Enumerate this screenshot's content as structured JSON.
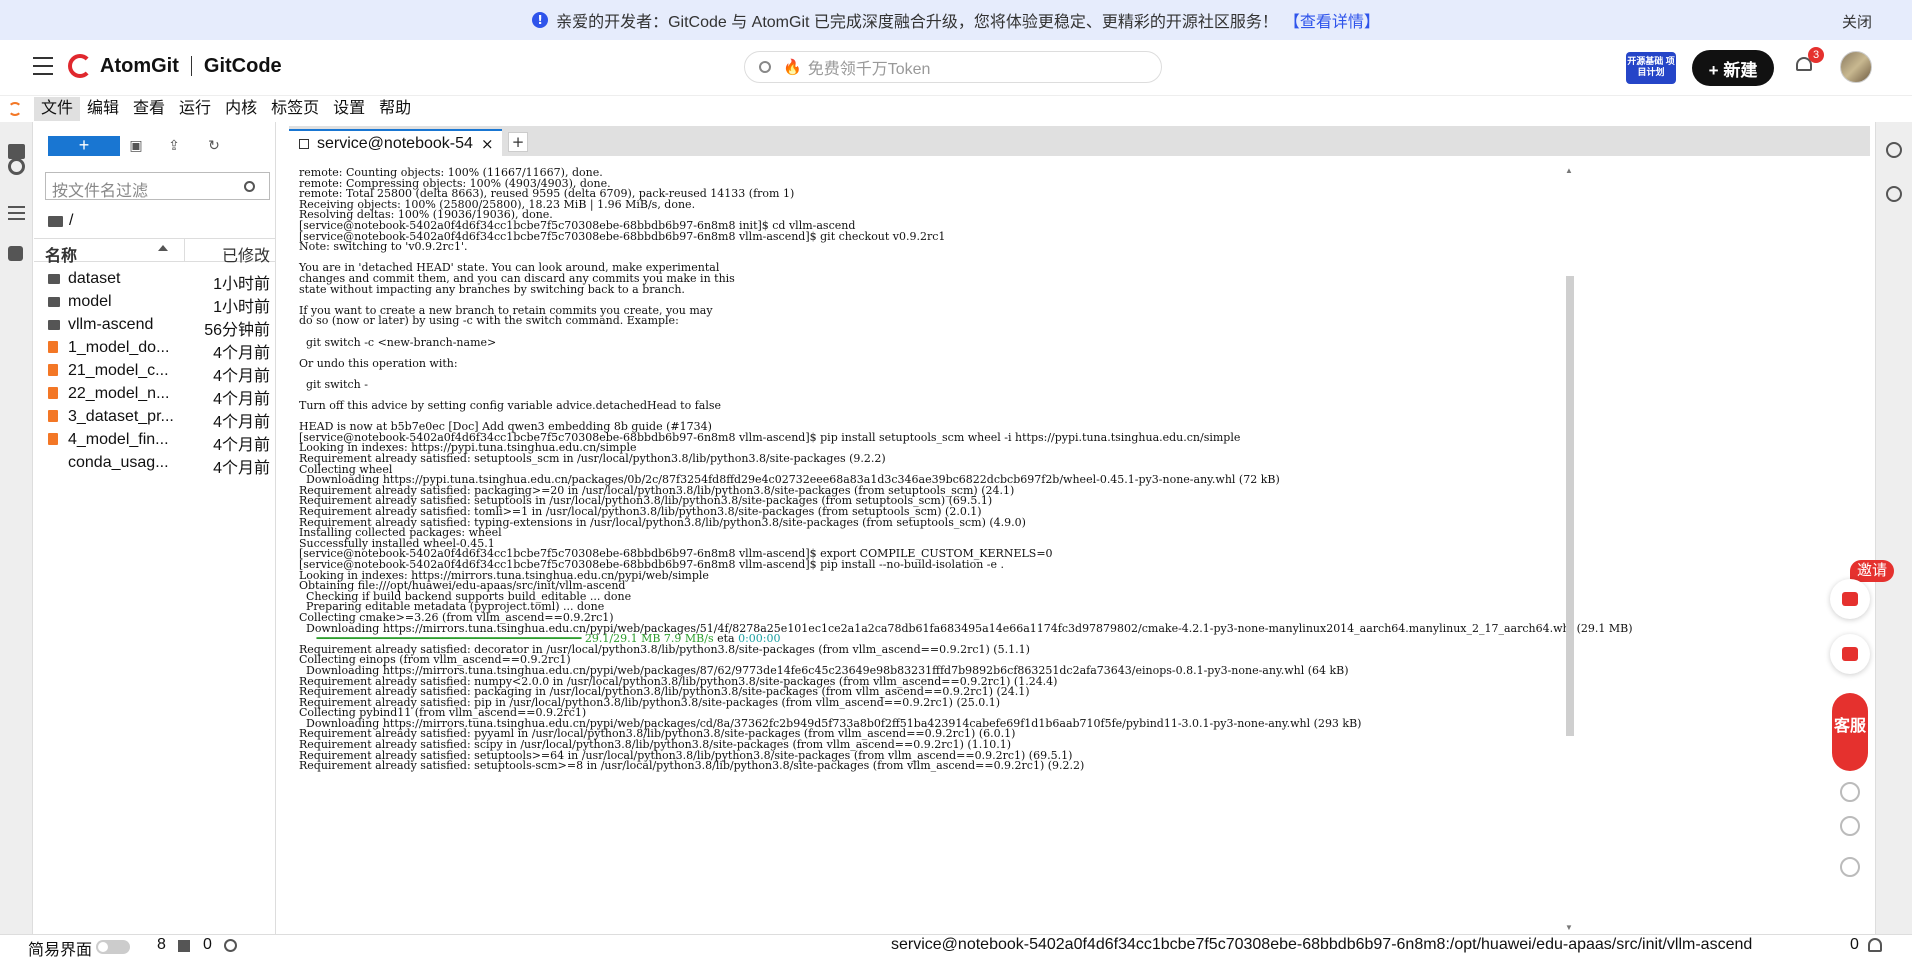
{
  "banner": {
    "text": "亲爱的开发者：GitCode 与 AtomGit 已完成深度融合升级，您将体验更稳定、更精彩的开源社区服务！",
    "link": "【查看详情】",
    "close": "关闭"
  },
  "topnav": {
    "brand_a": "AtomGit",
    "brand_b": "GitCode",
    "search_placeholder": "免费领千万Token",
    "promo": "开源基础 项目计划",
    "new_button": "+ 新建",
    "notification_count": "3"
  },
  "menubar": [
    "文件",
    "编辑",
    "查看",
    "运行",
    "内核",
    "标签页",
    "设置",
    "帮助"
  ],
  "filebrowser": {
    "new_label": "+",
    "filter_placeholder": "按文件名过滤",
    "breadcrumb": "/",
    "col_name": "名称",
    "col_modified": "已修改",
    "files": [
      {
        "name": "dataset",
        "time": "1小时前",
        "type": "folder"
      },
      {
        "name": "model",
        "time": "1小时前",
        "type": "folder"
      },
      {
        "name": "vllm-ascend",
        "time": "56分钟前",
        "type": "folder"
      },
      {
        "name": "1_model_do...",
        "time": "4个月前",
        "type": "notebook"
      },
      {
        "name": "21_model_c...",
        "time": "4个月前",
        "type": "notebook"
      },
      {
        "name": "22_model_n...",
        "time": "4个月前",
        "type": "notebook"
      },
      {
        "name": "3_dataset_pr...",
        "time": "4个月前",
        "type": "notebook"
      },
      {
        "name": "4_model_fin...",
        "time": "4个月前",
        "type": "notebook"
      },
      {
        "name": "conda_usag...",
        "time": "4个月前",
        "type": "pdf"
      }
    ]
  },
  "tab": {
    "label": "service@notebook-5402a0f4d6f34cc1bcbe7f5c70308ebe-68bbdb6b97-6n8m8",
    "close": "×",
    "add": "+"
  },
  "terminal": {
    "lines_a": "remote: Counting objects: 100% (11667/11667), done.\nremote: Compressing objects: 100% (4903/4903), done.\nremote: Total 25800 (delta 8663), reused 9595 (delta 6709), pack-reused 14133 (from 1)\nReceiving objects: 100% (25800/25800), 18.23 MiB | 1.96 MiB/s, done.\nResolving deltas: 100% (19036/19036), done.\n[service@notebook-5402a0f4d6f34cc1bcbe7f5c70308ebe-68bbdb6b97-6n8m8 init]$ cd vllm-ascend\n[service@notebook-5402a0f4d6f34cc1bcbe7f5c70308ebe-68bbdb6b97-6n8m8 vllm-ascend]$ git checkout v0.9.2rc1\nNote: switching to 'v0.9.2rc1'.\n\nYou are in 'detached HEAD' state. You can look around, make experimental\nchanges and commit them, and you can discard any commits you make in this\nstate without impacting any branches by switching back to a branch.\n\nIf you want to create a new branch to retain commits you create, you may\ndo so (now or later) by using -c with the switch command. Example:\n\n  git switch -c <new-branch-name>\n\nOr undo this operation with:\n\n  git switch -\n\nTurn off this advice by setting config variable advice.detachedHead to false\n\nHEAD is now at b5b7e0ec [Doc] Add qwen3 embedding 8b guide (#1734)\n[service@notebook-5402a0f4d6f34cc1bcbe7f5c70308ebe-68bbdb6b97-6n8m8 vllm-ascend]$ pip install setuptools_scm wheel -i https://pypi.tuna.tsinghua.edu.cn/simple\nLooking in indexes: https://pypi.tuna.tsinghua.edu.cn/simple\nRequirement already satisfied: setuptools_scm in /usr/local/python3.8/lib/python3.8/site-packages (9.2.2)\nCollecting wheel\n  Downloading https://pypi.tuna.tsinghua.edu.cn/packages/0b/2c/87f3254fd8ffd29e4c02732eee68a83a1d3c346ae39bc6822dcbcb697f2b/wheel-0.45.1-py3-none-any.whl (72 kB)\nRequirement already satisfied: packaging>=20 in /usr/local/python3.8/lib/python3.8/site-packages (from setuptools_scm) (24.1)\nRequirement already satisfied: setuptools in /usr/local/python3.8/lib/python3.8/site-packages (from setuptools_scm) (69.5.1)\nRequirement already satisfied: tomli>=1 in /usr/local/python3.8/lib/python3.8/site-packages (from setuptools_scm) (2.0.1)\nRequirement already satisfied: typing-extensions in /usr/local/python3.8/lib/python3.8/site-packages (from setuptools_scm) (4.9.0)\nInstalling collected packages: wheel\nSuccessfully installed wheel-0.45.1\n[service@notebook-5402a0f4d6f34cc1bcbe7f5c70308ebe-68bbdb6b97-6n8m8 vllm-ascend]$ export COMPILE_CUSTOM_KERNELS=0\n[service@notebook-5402a0f4d6f34cc1bcbe7f5c70308ebe-68bbdb6b97-6n8m8 vllm-ascend]$ pip install --no-build-isolation -e .\nLooking in indexes: https://mirrors.tuna.tsinghua.edu.cn/pypi/web/simple\nObtaining file:///opt/huawei/edu-apaas/src/init/vllm-ascend\n  Checking if build backend supports build_editable ... done\n  Preparing editable metadata (pyproject.toml) ... done\nCollecting cmake>=3.26 (from vllm_ascend==0.9.2rc1)\n  Downloading https://mirrors.tuna.tsinghua.edu.cn/pypi/web/packages/51/4f/8278a25e101ec1ce2a1a2ca78db61fa683495a14e66a1174fc3d97879802/cmake-4.2.1-py3-none-manylinux2014_aarch64.manylinux_2_17_aarch64.whl (29.1 MB)",
    "progress_bar": "     ━━━━━━━━━━━━━━━━━━━━━━━━━━━━━━━━━━━━━━━━ ",
    "progress_text": "29.1/29.1 MB 7.9 MB/s",
    "progress_eta": " eta ",
    "progress_time": "0:00:00",
    "lines_b": "Requirement already satisfied: decorator in /usr/local/python3.8/lib/python3.8/site-packages (from vllm_ascend==0.9.2rc1) (5.1.1)\nCollecting einops (from vllm_ascend==0.9.2rc1)\n  Downloading https://mirrors.tuna.tsinghua.edu.cn/pypi/web/packages/87/62/9773de14fe6c45c23649e98b83231fffd7b9892b6cf863251dc2afa73643/einops-0.8.1-py3-none-any.whl (64 kB)\nRequirement already satisfied: numpy<2.0.0 in /usr/local/python3.8/lib/python3.8/site-packages (from vllm_ascend==0.9.2rc1) (1.24.4)\nRequirement already satisfied: packaging in /usr/local/python3.8/lib/python3.8/site-packages (from vllm_ascend==0.9.2rc1) (24.1)\nRequirement already satisfied: pip in /usr/local/python3.8/lib/python3.8/site-packages (from vllm_ascend==0.9.2rc1) (25.0.1)\nCollecting pybind11 (from vllm_ascend==0.9.2rc1)\n  Downloading https://mirrors.tuna.tsinghua.edu.cn/pypi/web/packages/cd/8a/37362fc2b949d5f733a8b0f2ff51ba423914cabefe69f1d1b6aab710f5fe/pybind11-3.0.1-py3-none-any.whl (293 kB)\nRequirement already satisfied: pyyaml in /usr/local/python3.8/lib/python3.8/site-packages (from vllm_ascend==0.9.2rc1) (6.0.1)\nRequirement already satisfied: scipy in /usr/local/python3.8/lib/python3.8/site-packages (from vllm_ascend==0.9.2rc1) (1.10.1)\nRequirement already satisfied: setuptools>=64 in /usr/local/python3.8/lib/python3.8/site-packages (from vllm_ascend==0.9.2rc1) (69.5.1)\nRequirement already satisfied: setuptools-scm>=8 in /usr/local/python3.8/lib/python3.8/site-packages (from vllm_ascend==0.9.2rc1) (9.2.2)"
  },
  "floating": {
    "invite": "邀请",
    "service": "客服"
  },
  "statusbar": {
    "simple_mode": "简易界面",
    "count_a": "8",
    "count_b": "0",
    "path": "service@notebook-5402a0f4d6f34cc1bcbe7f5c70308ebe-68bbdb6b97-6n8m8:/opt/huawei/edu-apaas/src/init/vllm-ascend",
    "count_c": "0"
  },
  "colors": {
    "accent": "#1976d2",
    "banner_bg": "#e6ecfc",
    "brand_red": "#e0282e"
  }
}
